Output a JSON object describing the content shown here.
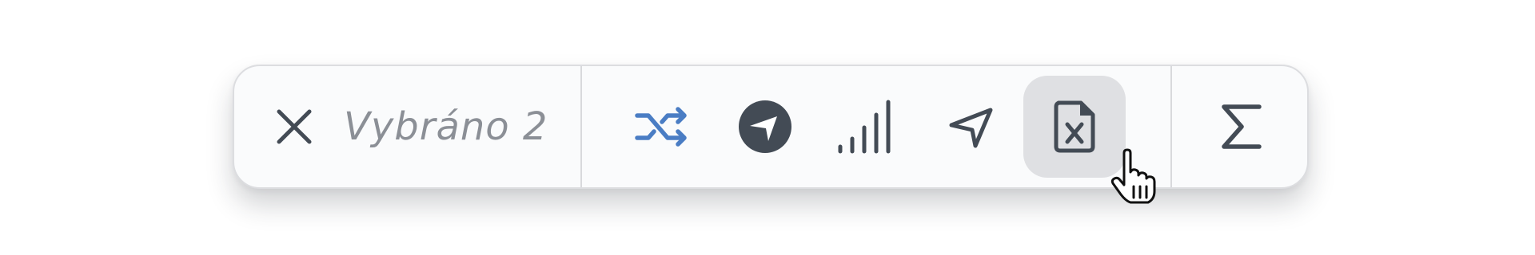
{
  "toolbar": {
    "selection_label": "Vybráno 2",
    "close_icon": "close-icon",
    "actions": [
      {
        "name": "shuffle-icon",
        "color": "#4a7dc4",
        "active": false
      },
      {
        "name": "navigation-circle-icon",
        "color": "#434b55",
        "active": false
      },
      {
        "name": "signal-bars-icon",
        "color": "#434b55",
        "active": false
      },
      {
        "name": "navigation-arrow-icon",
        "color": "#434b55",
        "active": false
      },
      {
        "name": "file-excel-icon",
        "color": "#434b55",
        "active": true
      }
    ],
    "sum_icon": "sigma-icon"
  },
  "colors": {
    "accent": "#4a7dc4",
    "icon": "#434b55",
    "active_bg": "#dfe0e3",
    "label": "#8b8f96"
  },
  "cursor": "hand-pointer-cursor"
}
